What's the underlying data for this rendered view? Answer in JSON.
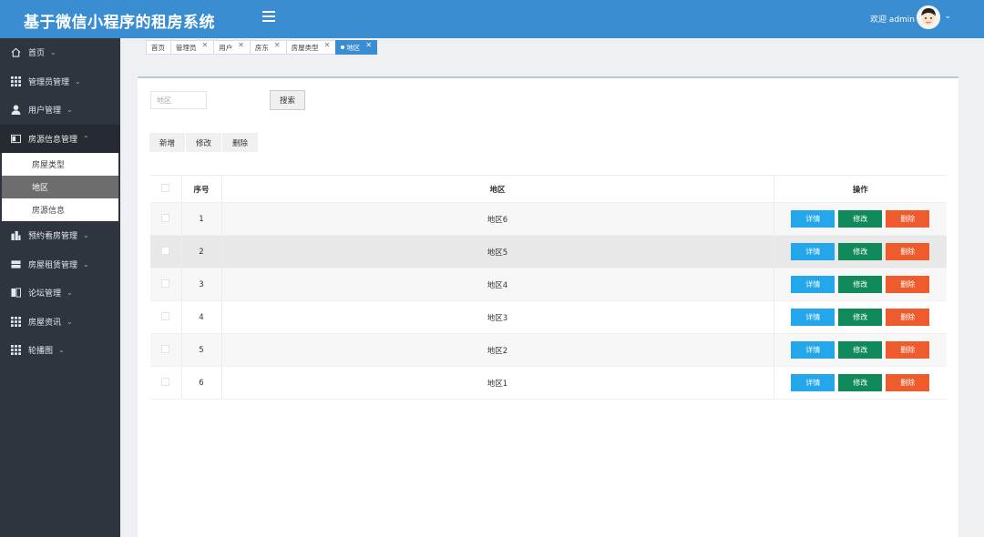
{
  "header": {
    "title": "基于微信小程序的租房系统",
    "welcome": "欢迎 admin"
  },
  "sidebar": {
    "items": [
      {
        "label": "首页",
        "icon": "home-icon"
      },
      {
        "label": "管理员管理",
        "icon": "grid-icon"
      },
      {
        "label": "用户管理",
        "icon": "user-icon"
      },
      {
        "label": "房源信息管理",
        "icon": "card-icon"
      },
      {
        "label": "预约看房管理",
        "icon": "building-icon"
      },
      {
        "label": "房屋租赁管理",
        "icon": "drawer-icon"
      },
      {
        "label": "论坛管理",
        "icon": "book-icon"
      },
      {
        "label": "房屋资讯",
        "icon": "grid-icon"
      },
      {
        "label": "轮播图",
        "icon": "grid-icon"
      }
    ],
    "submenu": [
      "房屋类型",
      "地区",
      "房源信息"
    ]
  },
  "tabs": [
    {
      "label": "首页"
    },
    {
      "label": "管理员"
    },
    {
      "label": "用户"
    },
    {
      "label": "房东"
    },
    {
      "label": "房屋类型"
    },
    {
      "label": "地区"
    }
  ],
  "search": {
    "placeholder": "地区",
    "button": "搜索"
  },
  "actions": {
    "add": "新增",
    "edit": "修改",
    "delete": "删除"
  },
  "table": {
    "headers": {
      "index": "序号",
      "region": "地区",
      "ops": "操作"
    },
    "rows": [
      {
        "index": "1",
        "region": "地区6"
      },
      {
        "index": "2",
        "region": "地区5"
      },
      {
        "index": "3",
        "region": "地区4"
      },
      {
        "index": "4",
        "region": "地区3"
      },
      {
        "index": "5",
        "region": "地区2"
      },
      {
        "index": "6",
        "region": "地区1"
      }
    ],
    "row_buttons": {
      "detail": "详情",
      "edit": "修改",
      "delete": "删除"
    }
  },
  "colors": {
    "header": "#3a8dd0",
    "sidebar": "#2f353f",
    "detail": "#23a7ea",
    "edit": "#108a5b",
    "delete": "#ee5b2d"
  }
}
